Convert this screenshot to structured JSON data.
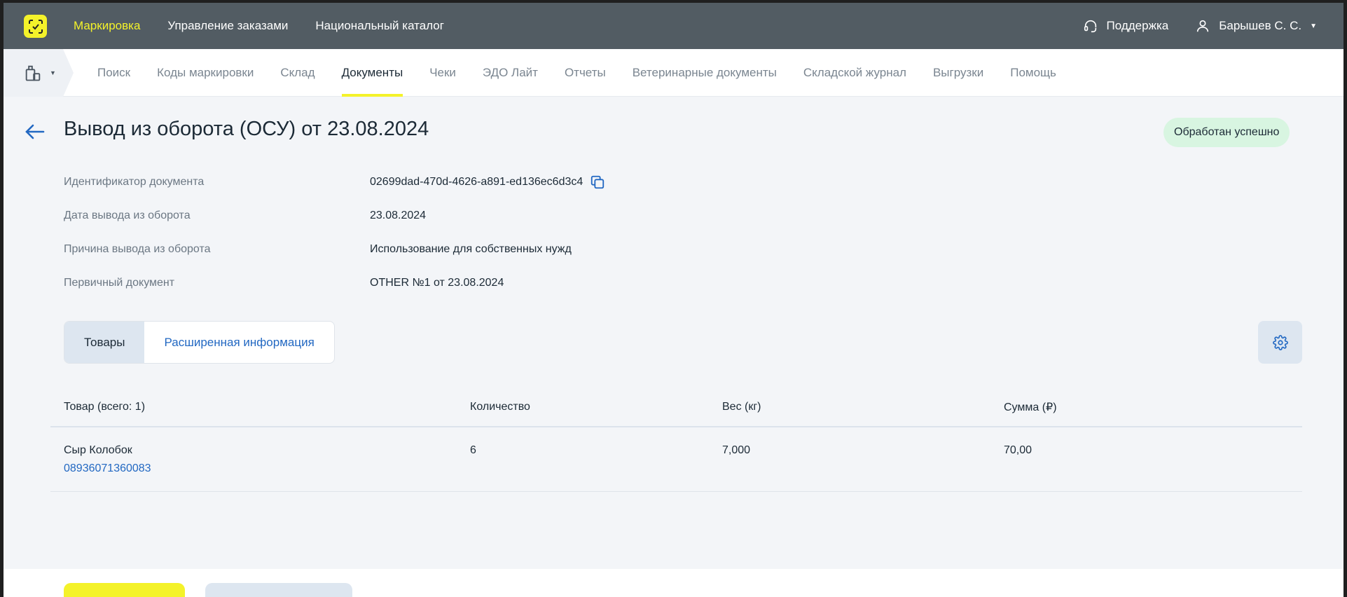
{
  "topbar": {
    "nav": [
      {
        "label": "Маркировка",
        "active": true
      },
      {
        "label": "Управление заказами",
        "active": false
      },
      {
        "label": "Национальный каталог",
        "active": false
      }
    ],
    "support_label": "Поддержка",
    "user_label": "Барышев С. С."
  },
  "subnav": {
    "items": [
      {
        "label": "Поиск"
      },
      {
        "label": "Коды маркировки"
      },
      {
        "label": "Склад"
      },
      {
        "label": "Документы"
      },
      {
        "label": "Чеки"
      },
      {
        "label": "ЭДО Лайт"
      },
      {
        "label": "Отчеты"
      },
      {
        "label": "Ветеринарные документы"
      },
      {
        "label": "Складской журнал"
      },
      {
        "label": "Выгрузки"
      },
      {
        "label": "Помощь"
      }
    ],
    "active_index": 3
  },
  "page": {
    "title": "Вывод из оборота (ОСУ) от 23.08.2024",
    "status": "Обработан успешно",
    "fields": [
      {
        "label": "Идентификатор документа",
        "value": "02699dad-470d-4626-a891-ed136ec6d3c4"
      },
      {
        "label": "Дата вывода из оборота",
        "value": "23.08.2024"
      },
      {
        "label": "Причина вывода из оборота",
        "value": "Использование для собственных нужд"
      },
      {
        "label": "Первичный документ",
        "value": "OTHER №1 от 23.08.2024"
      }
    ],
    "tabs": [
      {
        "label": "Товары"
      },
      {
        "label": "Расширенная информация"
      }
    ]
  },
  "table": {
    "headers": [
      "Товар (всего: 1)",
      "Количество",
      "Вес (кг)",
      "Сумма (₽)"
    ],
    "rows": [
      {
        "name": "Сыр Колобок",
        "code": "08936071360083",
        "qty": "6",
        "weight": "7,000",
        "sum": "70,00"
      }
    ]
  },
  "colors": {
    "accent_yellow": "#f4f22a",
    "topbar_bg": "#525c63",
    "link_blue": "#2268c2",
    "status_green_bg": "#d8f5e1"
  }
}
